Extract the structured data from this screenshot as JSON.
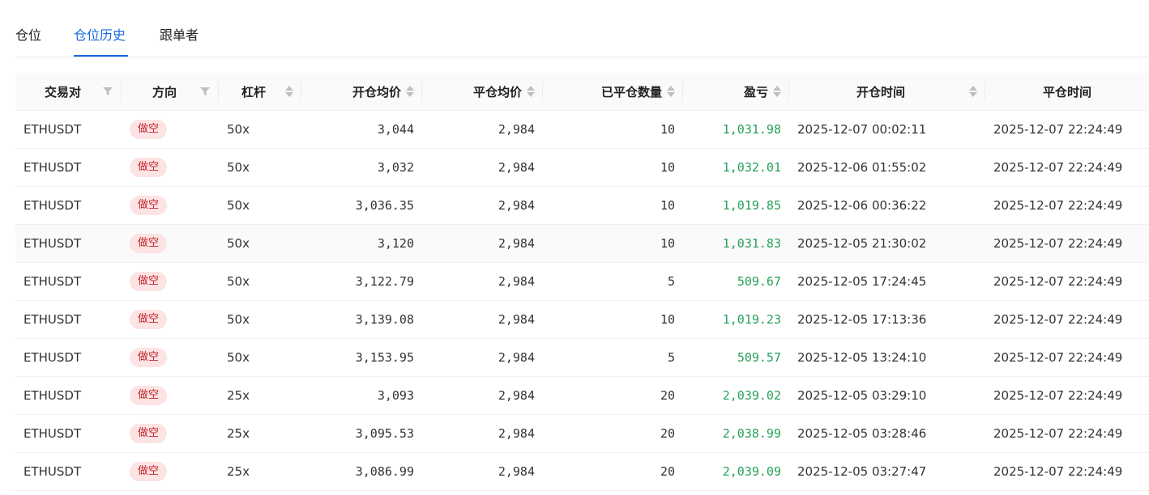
{
  "tabs": [
    {
      "label": "仓位",
      "active": false
    },
    {
      "label": "仓位历史",
      "active": true
    },
    {
      "label": "跟单者",
      "active": false
    }
  ],
  "colors": {
    "accent": "#1668dc",
    "profit": "#27a05a",
    "short_badge_bg": "#fde3e3",
    "short_badge_text": "#c0252b"
  },
  "table": {
    "headers": {
      "pair": "交易对",
      "direction": "方向",
      "leverage": "杠杆",
      "open_avg": "开仓均价",
      "close_avg": "平仓均价",
      "closed_qty": "已平仓数量",
      "pnl": "盈亏",
      "open_time": "开仓时间",
      "close_time": "平仓时间"
    },
    "rows": [
      {
        "pair": "ETHUSDT",
        "direction": "做空",
        "leverage": "50x",
        "open_avg": "3,044",
        "close_avg": "2,984",
        "closed_qty": "10",
        "pnl": "1,031.98",
        "open_time": "2025-12-07 00:02:11",
        "close_time": "2025-12-07 22:24:49"
      },
      {
        "pair": "ETHUSDT",
        "direction": "做空",
        "leverage": "50x",
        "open_avg": "3,032",
        "close_avg": "2,984",
        "closed_qty": "10",
        "pnl": "1,032.01",
        "open_time": "2025-12-06 01:55:02",
        "close_time": "2025-12-07 22:24:49"
      },
      {
        "pair": "ETHUSDT",
        "direction": "做空",
        "leverage": "50x",
        "open_avg": "3,036.35",
        "close_avg": "2,984",
        "closed_qty": "10",
        "pnl": "1,019.85",
        "open_time": "2025-12-06 00:36:22",
        "close_time": "2025-12-07 22:24:49"
      },
      {
        "pair": "ETHUSDT",
        "direction": "做空",
        "leverage": "50x",
        "open_avg": "3,120",
        "close_avg": "2,984",
        "closed_qty": "10",
        "pnl": "1,031.83",
        "open_time": "2025-12-05 21:30:02",
        "close_time": "2025-12-07 22:24:49"
      },
      {
        "pair": "ETHUSDT",
        "direction": "做空",
        "leverage": "50x",
        "open_avg": "3,122.79",
        "close_avg": "2,984",
        "closed_qty": "5",
        "pnl": "509.67",
        "open_time": "2025-12-05 17:24:45",
        "close_time": "2025-12-07 22:24:49"
      },
      {
        "pair": "ETHUSDT",
        "direction": "做空",
        "leverage": "50x",
        "open_avg": "3,139.08",
        "close_avg": "2,984",
        "closed_qty": "10",
        "pnl": "1,019.23",
        "open_time": "2025-12-05 17:13:36",
        "close_time": "2025-12-07 22:24:49"
      },
      {
        "pair": "ETHUSDT",
        "direction": "做空",
        "leverage": "50x",
        "open_avg": "3,153.95",
        "close_avg": "2,984",
        "closed_qty": "5",
        "pnl": "509.57",
        "open_time": "2025-12-05 13:24:10",
        "close_time": "2025-12-07 22:24:49"
      },
      {
        "pair": "ETHUSDT",
        "direction": "做空",
        "leverage": "25x",
        "open_avg": "3,093",
        "close_avg": "2,984",
        "closed_qty": "20",
        "pnl": "2,039.02",
        "open_time": "2025-12-05 03:29:10",
        "close_time": "2025-12-07 22:24:49"
      },
      {
        "pair": "ETHUSDT",
        "direction": "做空",
        "leverage": "25x",
        "open_avg": "3,095.53",
        "close_avg": "2,984",
        "closed_qty": "20",
        "pnl": "2,038.99",
        "open_time": "2025-12-05 03:28:46",
        "close_time": "2025-12-07 22:24:49"
      },
      {
        "pair": "ETHUSDT",
        "direction": "做空",
        "leverage": "25x",
        "open_avg": "3,086.99",
        "close_avg": "2,984",
        "closed_qty": "20",
        "pnl": "2,039.09",
        "open_time": "2025-12-05 03:27:47",
        "close_time": "2025-12-07 22:24:49"
      }
    ]
  }
}
